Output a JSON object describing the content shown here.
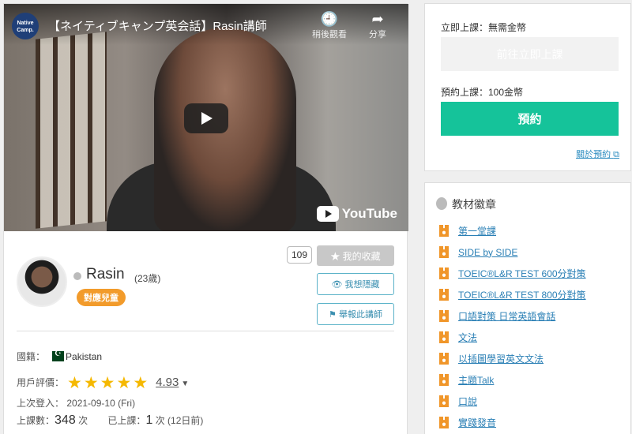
{
  "video": {
    "channel_logo_text": "Native Camp.",
    "title": "【ネイティブキャンプ英会話】Rasin講師",
    "watch_later_label": "稍後觀看",
    "share_label": "分享",
    "youtube_logo_text": "YouTube"
  },
  "teacher": {
    "favorite_count": "109",
    "favorite_label": "★ 我的收藏",
    "hide_label": "👁 我想隱藏",
    "report_label": "⚑ 舉報此講師",
    "name": "Rasin",
    "age": "(23歲)",
    "kids_badge": "對應兒童",
    "country_label": "國籍：",
    "country": "Pakistan",
    "rating_label": "用戶評價：",
    "rating_stars": "★★★★★",
    "rating_value": "4.93",
    "last_login_label": "上次登入：",
    "last_login": "2021-09-10 (Fri)",
    "lessons_label": "上課數：",
    "lessons_count": "348",
    "lessons_unit": "次",
    "taken_label": "已上課：",
    "taken_count": "1",
    "taken_unit": "次 (12日前)"
  },
  "booking": {
    "now_label": "立即上課：無需金幣",
    "now_button": "前往立即上課",
    "reserve_label": "預約上課：100金幣",
    "reserve_button": "預約",
    "about_link": "關於預約"
  },
  "badges": {
    "title": "教材徽章",
    "items": [
      "第一堂課",
      "SIDE by SIDE",
      "TOEIC®L&R TEST 600分對策",
      "TOEIC®L&R TEST 800分對策",
      "口語對策 日常英語會話",
      "文法",
      "以插圖學習英文文法",
      "主題Talk",
      "口說",
      "實踐發音"
    ]
  },
  "colors": {
    "primary": "#15c39a",
    "badge_orange": "#f29b2b",
    "link_blue": "#2a7fb5",
    "star_yellow": "#f5b800"
  }
}
